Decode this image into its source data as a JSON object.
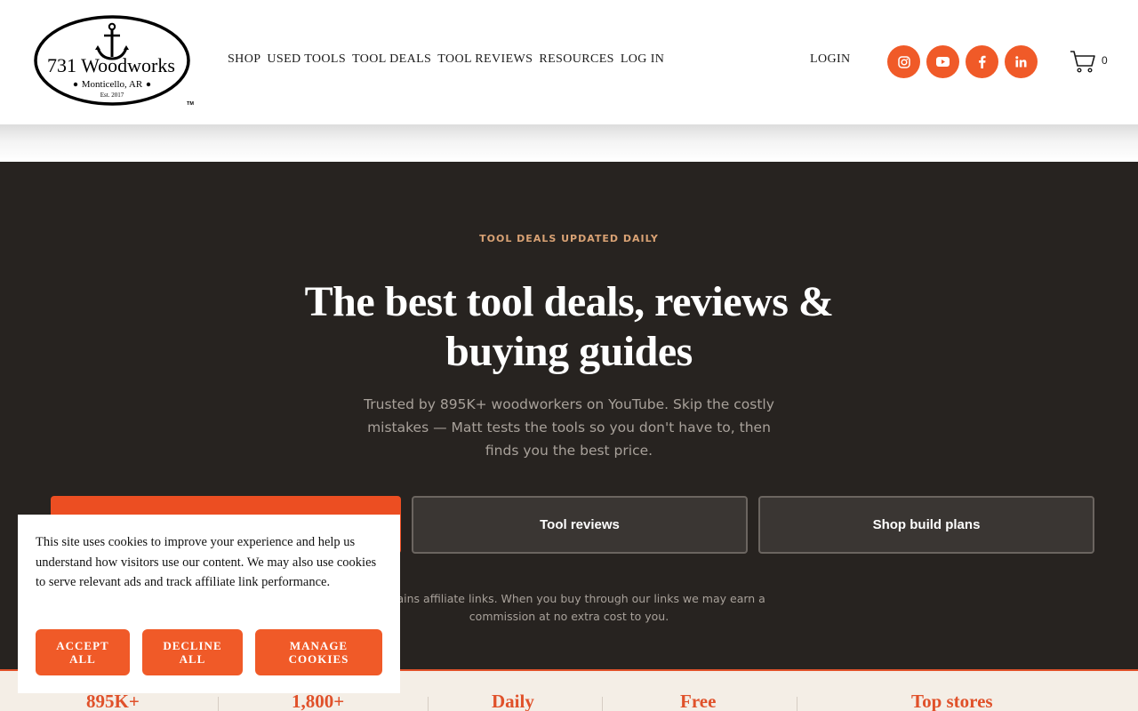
{
  "header": {
    "logo": {
      "name": "731 Woodworks",
      "location": "Monticello, AR",
      "established": "Est. 2017",
      "trademark": "TM"
    },
    "nav": [
      "SHOP",
      "USED TOOLS",
      "TOOL DEALS",
      "TOOL REVIEWS",
      "RESOURCES",
      "LOG IN"
    ],
    "login_label": "LOGIN",
    "social_icons": [
      "instagram-icon",
      "youtube-icon",
      "facebook-icon",
      "linkedin-icon"
    ],
    "cart_count": "0",
    "accent_color": "#f05a28"
  },
  "hero": {
    "kicker": "TOOL DEALS UPDATED DAILY",
    "headline": "The best tool deals, reviews & buying guides",
    "subtitle": "Trusted by 895K+ woodworkers on YouTube. Skip the costly mistakes — Matt tests the tools so you don't have to, then finds you the best price.",
    "buttons": {
      "reviews": "Tool reviews",
      "plans": "Shop build plans"
    },
    "disclaimer": "contains affiliate links. When you buy through our links we may earn a commission at no extra cost to you.",
    "background_color": "#272320"
  },
  "stats": [
    "895K+",
    "1,800+",
    "Daily",
    "Free",
    "Top stores"
  ],
  "cookie": {
    "text": "This site uses cookies to improve your experience and help us understand how visitors use our content. We may also use cookies to serve relevant ads and track affiliate link performance.",
    "accept": "ACCEPT\nALL",
    "decline": "DECLINE\nALL",
    "manage": "MANAGE\nCOOKIES"
  }
}
